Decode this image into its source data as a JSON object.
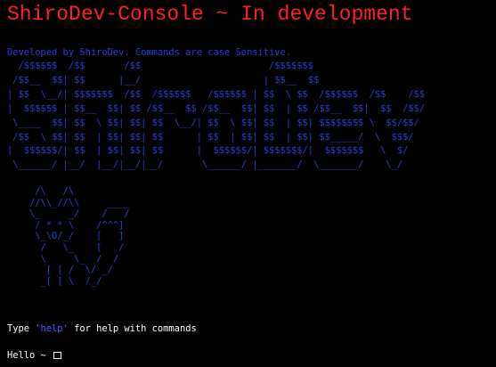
{
  "console": {
    "title": "ShiroDev-Console ~ In development",
    "info_text": "Developed by ShiroDev. Commands are case Sensitive.",
    "banner_ascii": "  /$$$$$$  /$$       /$$                       /$$$$$$$\n /$$__  $$| $$      |__/                      | $$__  $$\n| $$  \\__/| $$$$$$$  /$$  /$$$$$$   /$$$$$$ | $$  \\ $$  /$$$$$$  /$$    /$$\n|  $$$$$$ | $$__  $$| $$ /$$__  $$ /$$__  $$| $$  | $$ /$$__  $$|  $$  /$$/\n \\____  $$| $$  \\ $$| $$| $$  \\__/| $$  \\ $$| $$  | $$| $$$$$$$$ \\  $$/$$/\n /$$  \\ $$| $$  | $$| $$| $$      | $$  | $$| $$  | $$| $$_____/  \\  $$$/\n|  $$$$$$/| $$  | $$| $$| $$      |  $$$$$$/| $$$$$$$/|  $$$$$$$   \\  $/\n \\______/ |__/  |__/|__/|__/       \\______/ |_______/  \\_______/    \\_/",
    "cat_ascii": "     /\\   /\\\n    //\\\\_//\\\\     ____\n    \\_     _/    /   /\n     / * * \\    /^^^]\n     \\_\\O/_/    [   ]\n      /   \\_    [   /\n      \\     \\_  /  /\n       [ [ /  \\/ _/\n      _[ [ \\  /_/",
    "help_prefix": "Type ",
    "help_command": "'help'",
    "help_suffix": " for help with commands",
    "prompt_text": "Hello ~ "
  },
  "colors": {
    "title": "#ff1f1f",
    "ascii": "#2a3dd6",
    "command": "#4a5bff",
    "text": "#ffffff",
    "background": "#000000"
  },
  "icons": {
    "cursor": "block-cursor-icon"
  }
}
